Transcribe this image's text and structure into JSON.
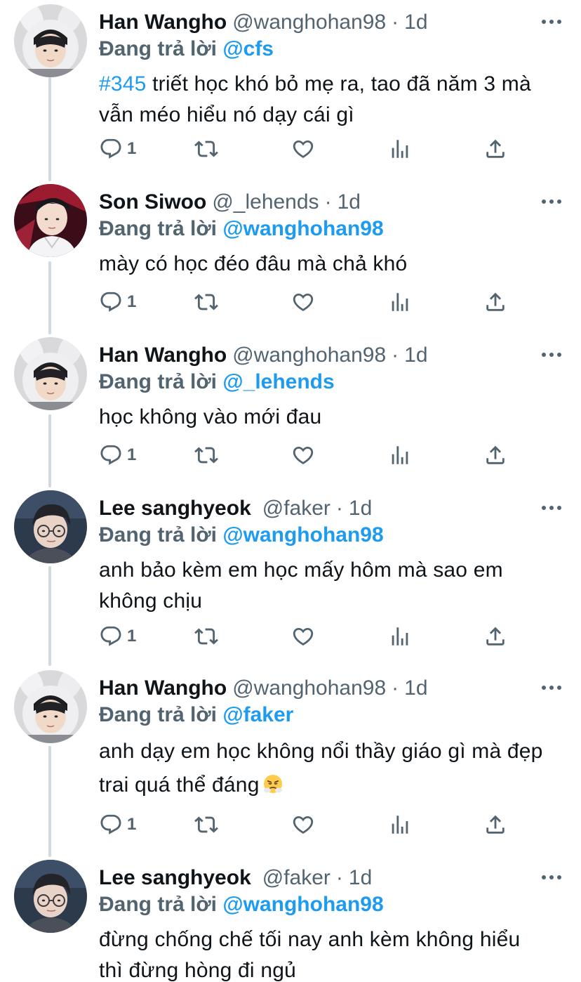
{
  "tweets": [
    {
      "display_name": "Han Wangho",
      "handle": "@wanghohan98",
      "time": "1d",
      "replying_label": "Đang trả lời",
      "replying_to": "@cfs",
      "hashtag": "#345",
      "text": "triết học khó bỏ mẹ ra, tao  đã năm 3 mà vẫn méo hiểu nó dạy cái gì",
      "reply_count": "1",
      "avatar_icon": "avatar-bunny-hood-icon"
    },
    {
      "display_name": "Son Siwoo",
      "handle": "@_lehends",
      "time": "1d",
      "replying_label": "Đang trả lời",
      "replying_to": "@wanghohan98",
      "text": "mày có học đéo đâu mà chả khó",
      "reply_count": "1",
      "avatar_icon": "avatar-red-bg-icon"
    },
    {
      "display_name": "Han Wangho",
      "handle": "@wanghohan98",
      "time": "1d",
      "replying_label": "Đang trả lời",
      "replying_to": "@_lehends",
      "text": "học không vào mới đau",
      "reply_count": "1",
      "avatar_icon": "avatar-bunny-hood-icon"
    },
    {
      "display_name": "Lee sanghyeok",
      "handle": "@faker",
      "time": "1d",
      "replying_label": "Đang trả lời",
      "replying_to": "@wanghohan98",
      "text": "anh bảo kèm em học mấy hôm mà sao em không chịu",
      "reply_count": "1",
      "avatar_icon": "avatar-glasses-icon"
    },
    {
      "display_name": "Han Wangho",
      "handle": "@wanghohan98",
      "time": "1d",
      "replying_label": "Đang trả lời",
      "replying_to": "@faker",
      "text": "anh dạy em học không nổi thầy giáo gì mà đẹp trai quá thể đáng",
      "emoji": "steam-from-nose-emoji",
      "reply_count": "1",
      "avatar_icon": "avatar-bunny-hood-icon"
    },
    {
      "display_name": "Lee sanghyeok",
      "handle": "@faker",
      "time": "1d",
      "replying_label": "Đang trả lời",
      "replying_to": "@wanghohan98",
      "text": "đừng chống chế tối nay anh kèm không hiểu thì đừng hòng đi ngủ",
      "avatar_icon": "avatar-glasses-icon"
    }
  ],
  "separator": "·",
  "colors": {
    "accent": "#1d9bf0",
    "secondary_text": "#536471",
    "primary_text": "#0f1419",
    "thread_line": "#cfd9de"
  }
}
